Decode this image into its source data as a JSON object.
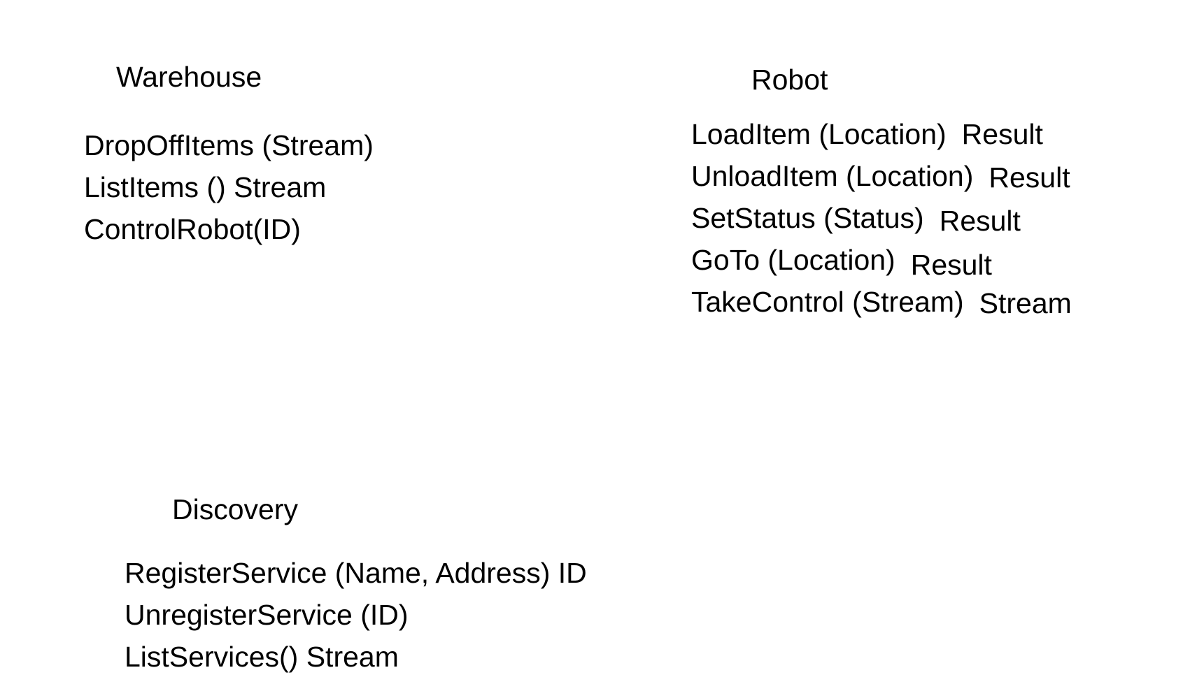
{
  "services": {
    "warehouse": {
      "title": "Warehouse",
      "methods": [
        {
          "signature": "DropOffItems (Stream)",
          "returns": ""
        },
        {
          "signature": "ListItems () Stream",
          "returns": ""
        },
        {
          "signature": "ControlRobot(ID)",
          "returns": ""
        }
      ]
    },
    "robot": {
      "title": "Robot",
      "methods": [
        {
          "signature": "LoadItem (Location)",
          "returns": "Result"
        },
        {
          "signature": "UnloadItem (Location)",
          "returns": "Result"
        },
        {
          "signature": "SetStatus (Status)",
          "returns": "Result"
        },
        {
          "signature": "GoTo (Location)",
          "returns": "Result"
        },
        {
          "signature": "TakeControl (Stream)",
          "returns": "Stream"
        }
      ]
    },
    "discovery": {
      "title": "Discovery",
      "methods": [
        {
          "signature": "RegisterService (Name, Address) ID",
          "returns": ""
        },
        {
          "signature": "UnregisterService (ID)",
          "returns": ""
        },
        {
          "signature": "ListServices() Stream",
          "returns": ""
        }
      ]
    }
  }
}
